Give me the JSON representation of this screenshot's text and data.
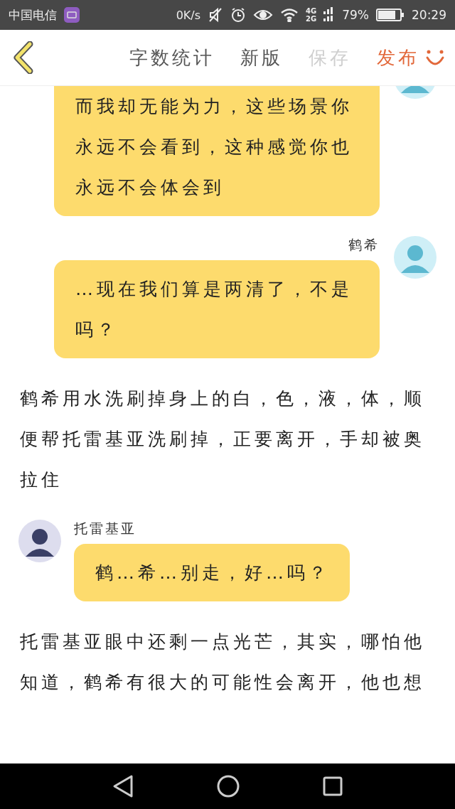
{
  "status_bar": {
    "carrier": "中国电信",
    "speed": "0K/s",
    "network_top": "4G",
    "network_bottom": "2G",
    "battery": "79%",
    "time": "20:29"
  },
  "toolbar": {
    "actions": [
      {
        "label": "字数统计",
        "kind": "normal"
      },
      {
        "label": "新版",
        "kind": "normal"
      },
      {
        "label": "保存",
        "kind": "disabled"
      },
      {
        "label": "发布",
        "kind": "primary"
      }
    ]
  },
  "messages": [
    {
      "kind": "outgoing",
      "clipped": true,
      "text": "而我却无能为力，这些场景你永远不会看到，这种感觉你也永远不会体会到"
    },
    {
      "kind": "outgoing",
      "clipped": false,
      "speaker": "鹤希",
      "text": "…现在我们算是两清了，不是吗？"
    },
    {
      "kind": "narration",
      "text": "鹤希用水洗刷掉身上的白，色，液，体，顺便帮托雷基亚洗刷掉，正要离开，手却被奥拉住"
    },
    {
      "kind": "incoming",
      "clipped": false,
      "speaker": "托雷基亚",
      "text": "鹤…希…别走，好…吗？"
    },
    {
      "kind": "narration",
      "text": "托雷基亚眼中还剩一点光芒，其实，哪怕他知道，鹤希有很大的可能性会离开，他也想"
    }
  ]
}
